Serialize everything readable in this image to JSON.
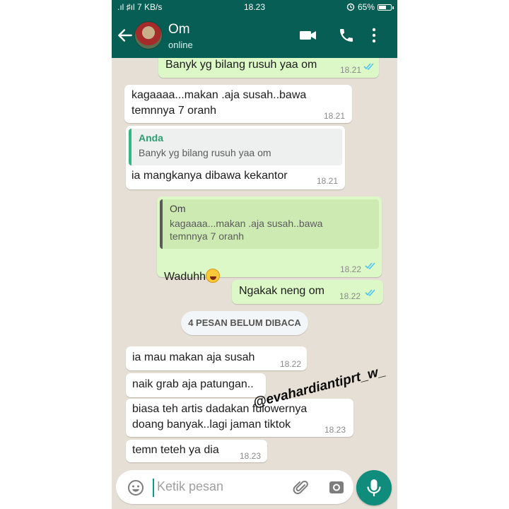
{
  "status_bar": {
    "network": ".ıl ♯ıl 7 KB/s",
    "time": "18.23",
    "battery": "65%",
    "battery_level": 0.65
  },
  "header": {
    "contact_name": "Om",
    "contact_status": "online"
  },
  "icons": [
    "back-arrow-icon",
    "avatar",
    "video-call-icon",
    "phone-call-icon",
    "more-options-icon",
    "emoji-icon",
    "attach-icon",
    "camera-icon",
    "mic-icon",
    "double-check-icon"
  ],
  "messages": [
    {
      "direction": "outgoing",
      "text": "Banyk yg bilang rusuh yaa om",
      "time": "18.21",
      "status": "read"
    },
    {
      "direction": "incoming",
      "text": "kagaaaa...makan .aja susah..bawa\ntemnnya 7 oranh",
      "time": "18.21"
    },
    {
      "direction": "incoming",
      "quote_author": "Anda",
      "quote_text": "Banyk yg bilang rusuh yaa om",
      "text": "ia mangkanya dibawa kekantor",
      "time": "18.21"
    },
    {
      "direction": "outgoing",
      "quote_author": "Om",
      "quote_text": "kagaaaa...makan .aja susah..bawa\ntemnnya 7 oranh",
      "text": "Waduhh",
      "emoji": "rolling-on-floor-laughing",
      "time": "18.22",
      "status": "read"
    },
    {
      "direction": "outgoing",
      "text": "Ngakak neng om",
      "time": "18.22",
      "status": "read"
    },
    {
      "direction": "incoming",
      "text": "ia mau makan aja susah",
      "time": "18.22"
    },
    {
      "direction": "incoming",
      "text": "naik grab aja patungan..",
      "time": ""
    },
    {
      "direction": "incoming",
      "text": "biasa teh artis dadakan fulowernya\ndoang banyak..lagi jaman tiktok",
      "time": "18.23"
    },
    {
      "direction": "incoming",
      "text": "temn teteh ya dia",
      "time": "18.23"
    }
  ],
  "unread_banner": "4 PESAN BELUM DIBACA",
  "watermark": "@evahardiantiprt_w_",
  "input": {
    "placeholder": "Ketik pesan"
  },
  "colors": {
    "header": "#075e54",
    "outgoing_bubble": "#dcf8c6",
    "incoming_bubble": "#ffffff",
    "read_ticks": "#4fc3f7",
    "mic_button": "#0f8c7b",
    "chat_background": "#e6dfd5"
  }
}
